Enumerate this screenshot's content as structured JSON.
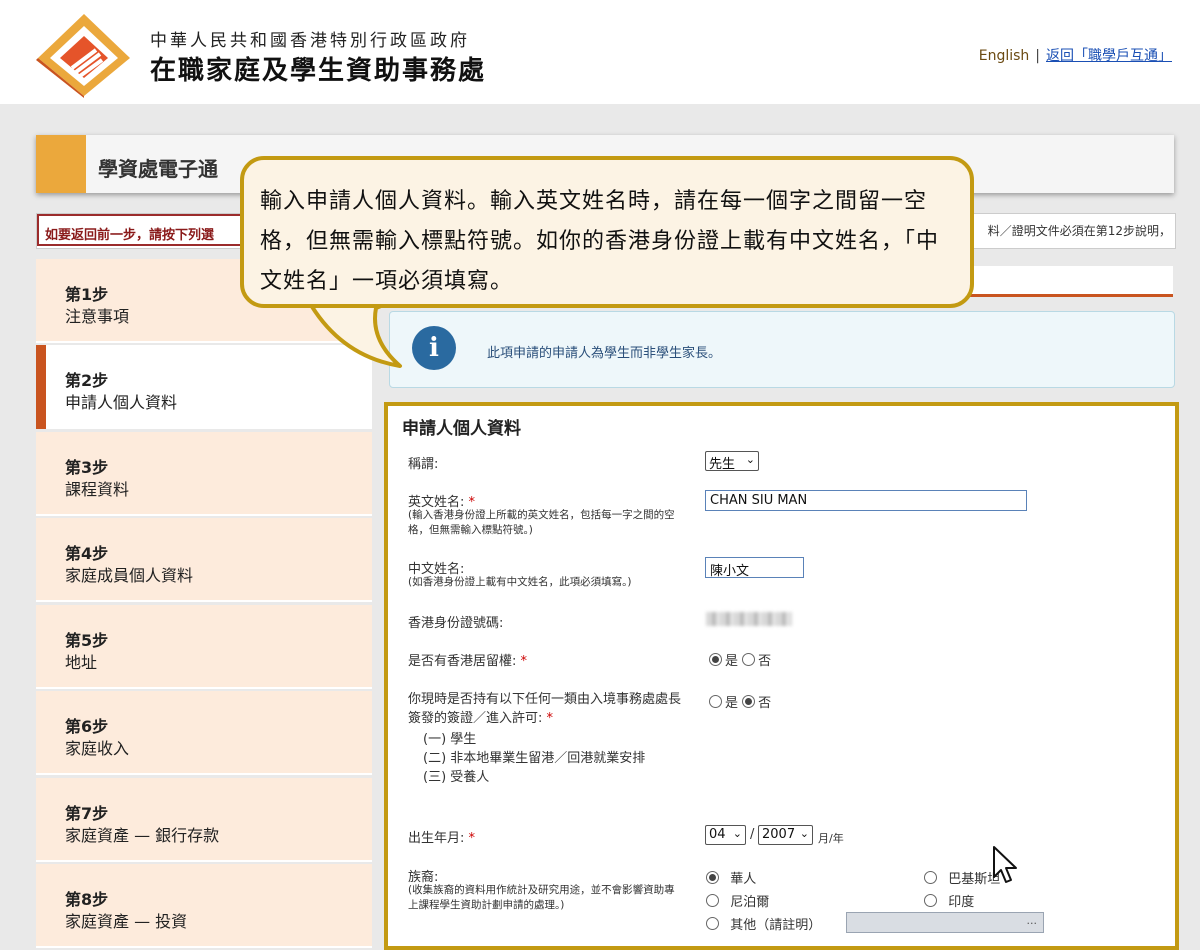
{
  "header": {
    "dept_line1": "中華人民共和國香港特別行政區政府",
    "dept_line2": "在職家庭及學生資助事務處",
    "link_english": "English",
    "link_separator": "|",
    "link_back": "返回「職學戶互通」"
  },
  "page_title": "學資處電子通",
  "back_notice": "如要返回前一步，請按下列選",
  "back_notice_right": "料／證明文件必須在第12步說明，",
  "callout": "輸入申請人個人資料。輸入英文姓名時，請在每一個字之間留一空格，但無需輸入標點符號。如你的香港身份證上載有中文姓名，「中文姓名」一項必須填寫。",
  "sidebar": {
    "steps": [
      {
        "num": "第1步",
        "label": "注意事項"
      },
      {
        "num": "第2步",
        "label": "申請人個人資料"
      },
      {
        "num": "第3步",
        "label": "課程資料"
      },
      {
        "num": "第4步",
        "label": "家庭成員個人資料"
      },
      {
        "num": "第5步",
        "label": "地址"
      },
      {
        "num": "第6步",
        "label": "家庭收入"
      },
      {
        "num": "第7步",
        "label": "家庭資產 — 銀行存款"
      },
      {
        "num": "第8步",
        "label": "家庭資產 — 投資"
      }
    ],
    "active_index": 1
  },
  "info": {
    "icon": "info-icon",
    "text": "此項申請的申請人為學生而非學生家長。"
  },
  "form": {
    "title": "申請人個人資料",
    "title_field": {
      "label": "稱謂:",
      "value": "先生"
    },
    "eng_name": {
      "label": "英文姓名:",
      "required_mark": "*",
      "note": "(輸入香港身份證上所載的英文姓名，包括每一字之間的空格，但無需輸入標點符號。)",
      "value": "CHAN SIU MAN"
    },
    "chi_name": {
      "label": "中文姓名:",
      "note": "(如香港身份證上載有中文姓名，此項必須填寫。)",
      "value": "陳小文"
    },
    "hkid": {
      "label": "香港身份證號碼:"
    },
    "right_of_abode": {
      "label": "是否有香港居留權:",
      "required_mark": "*",
      "yes": "是",
      "no": "否",
      "selected": "yes"
    },
    "visa": {
      "label": "你現時是否持有以下任何一類由入境事務處處長簽發的簽證／進入許可:",
      "required_mark": "*",
      "items": [
        "(一) 學生",
        "(二) 非本地畢業生留港／回港就業安排",
        "(三) 受養人"
      ],
      "yes": "是",
      "no": "否",
      "selected": "no"
    },
    "dob": {
      "label": "出生年月:",
      "required_mark": "*",
      "month": "04",
      "separator": "/",
      "year": "2007",
      "unit": "月/年"
    },
    "ethnicity": {
      "label": "族裔:",
      "note": "(收集族裔的資料用作統計及研究用途，並不會影響資助專上課程學生資助計劃申請的處理。)",
      "options": [
        "華人",
        "巴基斯坦",
        "尼泊爾",
        "印度",
        "其他（請註明）"
      ],
      "selected": "華人",
      "other_field_button": "..."
    }
  },
  "colors": {
    "accent_orange": "#eba83c",
    "active_red": "#c9541f",
    "callout_border": "#c39a12",
    "link_blue": "#1a4fb4"
  }
}
